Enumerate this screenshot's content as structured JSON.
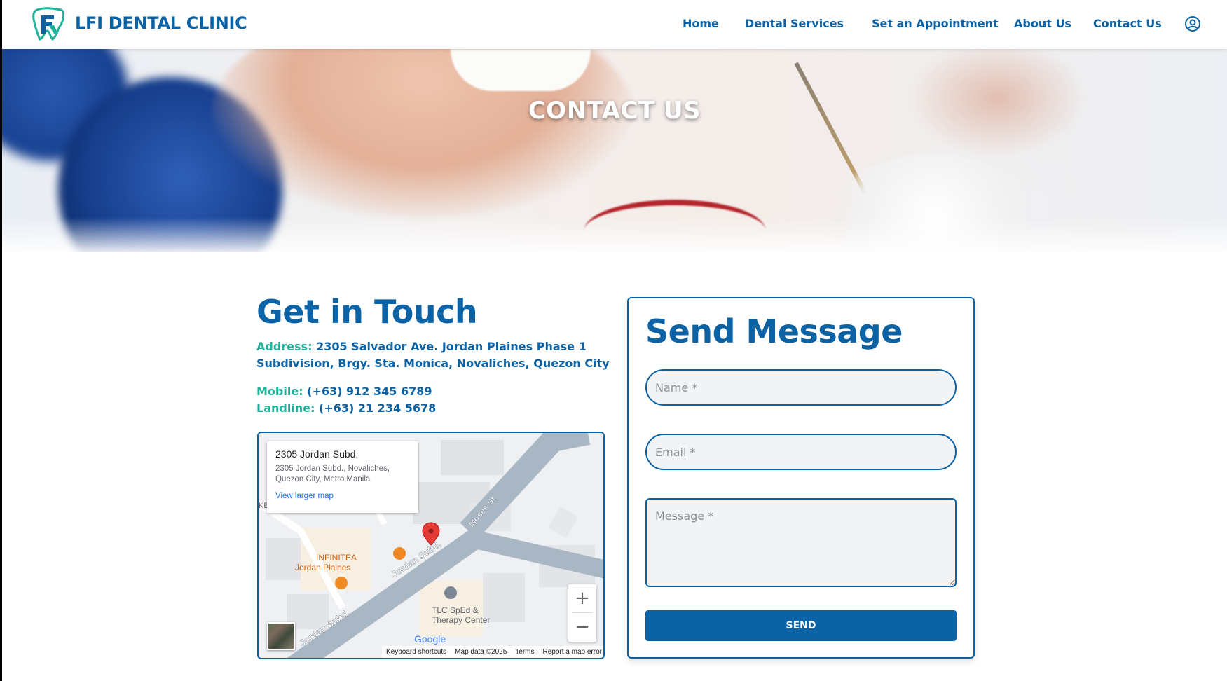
{
  "brand": {
    "name": "LFI DENTAL CLINIC",
    "colors": {
      "primary": "#0b62a4",
      "accent": "#1eb39a"
    }
  },
  "nav": {
    "items": [
      {
        "label": "Home"
      },
      {
        "label": "Dental Services"
      },
      {
        "label": "Set an Appointment"
      },
      {
        "label": "About Us"
      },
      {
        "label": "Contact Us"
      }
    ],
    "user_icon": "user-circle-icon"
  },
  "hero": {
    "title": "CONTACT US"
  },
  "contact": {
    "heading": "Get in Touch",
    "address_label": "Address:",
    "address_line1": "2305 Salvador Ave. Jordan Plaines Phase 1",
    "address_line2": "Subdivision, Brgy. Sta. Monica, Novaliches, Quezon City",
    "mobile_label": "Mobile:",
    "mobile": "(+63) 912 345 6789",
    "landline_label": "Landline:",
    "landline": "(+63) 21 234 5678"
  },
  "map": {
    "card_title": "2305 Jordan Subd.",
    "card_address": "2305 Jordan Subd., Novaliches, Quezon City, Metro Manila",
    "card_link": "View larger map",
    "labels": {
      "moses": "Moses St",
      "jordan1": "Jordan Subd.",
      "jordan2": "Jordan Subd.",
      "infinitea1": "INFINITEA",
      "infinitea2": "Jordan Plaines",
      "tlc1": "TLC SpEd &",
      "tlc2": "Therapy Center",
      "cut": "KE"
    },
    "zoom_in": "+",
    "zoom_out": "−",
    "google": "Google",
    "footer": {
      "shortcuts": "Keyboard shortcuts",
      "data": "Map data ©2025",
      "terms": "Terms",
      "report": "Report a map error"
    }
  },
  "form": {
    "heading": "Send Message",
    "name_placeholder": "Name *",
    "email_placeholder": "Email *",
    "message_placeholder": "Message *",
    "send_label": "SEND"
  }
}
